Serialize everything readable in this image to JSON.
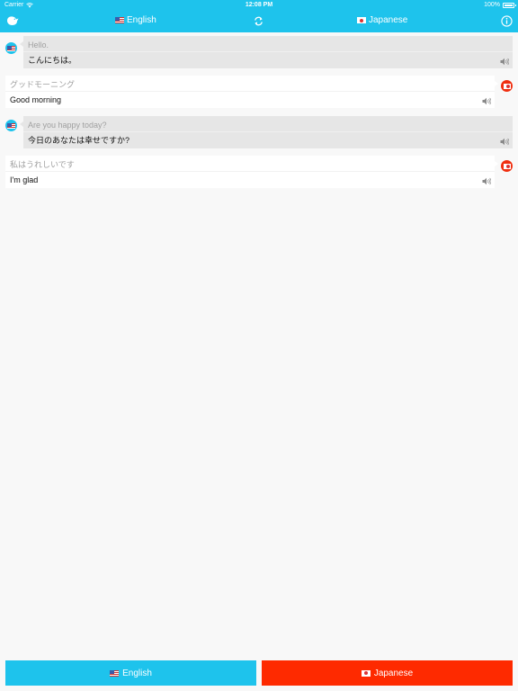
{
  "status_bar": {
    "carrier": "Carrier",
    "time": "12:08 PM",
    "battery": "100%"
  },
  "header": {
    "logo_icon": "bird-logo-icon",
    "left_language": "English",
    "right_language": "Japanese",
    "swap_icon": "swap-arrows-icon",
    "info_icon": "info-icon",
    "left_flag": "us-flag-icon",
    "right_flag": "jp-flag-icon"
  },
  "conversation": [
    {
      "speaker": "english",
      "source": "Hello.",
      "translation": "こんにちは。"
    },
    {
      "speaker": "japanese",
      "source": "グッドモーニング",
      "translation": "Good morning"
    },
    {
      "speaker": "english",
      "source": "Are you happy today?",
      "translation": "今日のあなたは幸せですか?"
    },
    {
      "speaker": "japanese",
      "source": "私はうれしいです",
      "translation": "I'm glad"
    }
  ],
  "bottom": {
    "english_button": "English",
    "japanese_button": "Japanese"
  },
  "colors": {
    "accent_cyan": "#1ec3ec",
    "accent_red": "#fe2a00",
    "background": "#f8f8f8"
  }
}
